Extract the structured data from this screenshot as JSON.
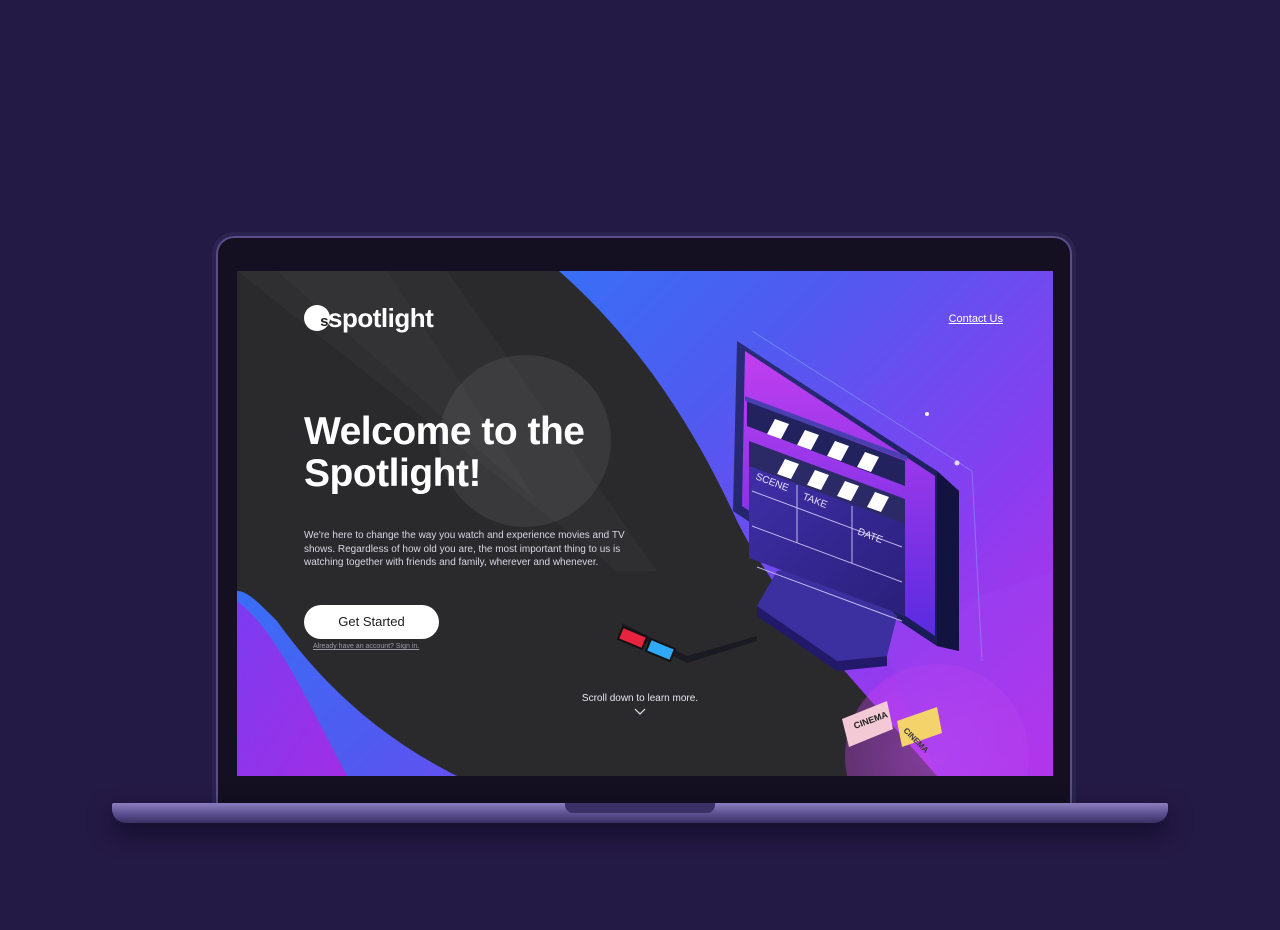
{
  "site": {
    "logo_mark": "s",
    "logo_text": "spotlight",
    "nav_contact": "Contact Us"
  },
  "hero": {
    "title": "Welcome to the Spotlight!",
    "body": "We're here to change the way you watch and experience movies and TV shows. Regardless of how old you are, the most important thing to us is watching together with friends and family, wherever and whenever.",
    "cta_label": "Get Started",
    "signin_text": "Already have an account? Sign in."
  },
  "scroll_hint": "Scroll down to learn more.",
  "illustration": {
    "clapperboard_labels": [
      "SCENE",
      "TAKE",
      "DATE"
    ],
    "ticket_text": "CINEMA",
    "icons": [
      "clapperboard-icon",
      "monitor-icon",
      "3d-glasses-icon",
      "cinema-tickets-icon",
      "chevron-down-icon"
    ]
  },
  "colors": {
    "page_bg": "#241a46",
    "dark_panel": "#2a2a2c",
    "accent_blue": "#1e86ff",
    "accent_purple": "#8a3df0",
    "accent_magenta": "#c02ee8"
  }
}
